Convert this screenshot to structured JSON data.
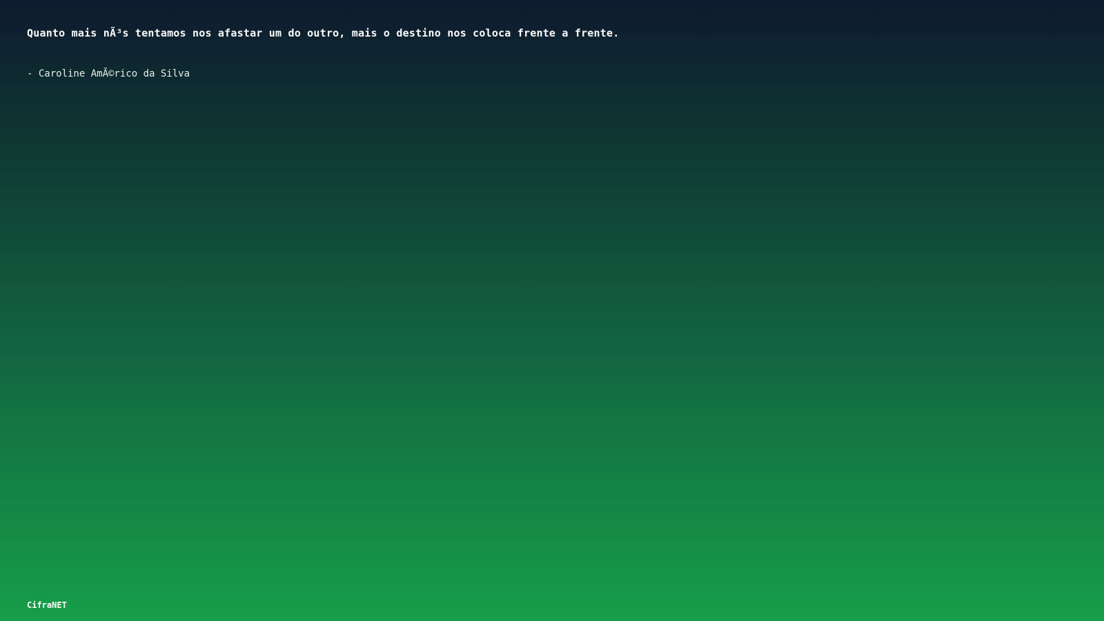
{
  "quote": {
    "text": "Quanto mais nÃ³s tentamos nos afastar um do outro, mais o destino nos coloca frente a frente.",
    "author": "- Caroline AmÃ©rico da Silva"
  },
  "footer": {
    "brand": "CifraNET"
  },
  "colors": {
    "gradient_top": "#0e1a2e",
    "gradient_bottom": "#169e48",
    "text": "#ffffff"
  }
}
